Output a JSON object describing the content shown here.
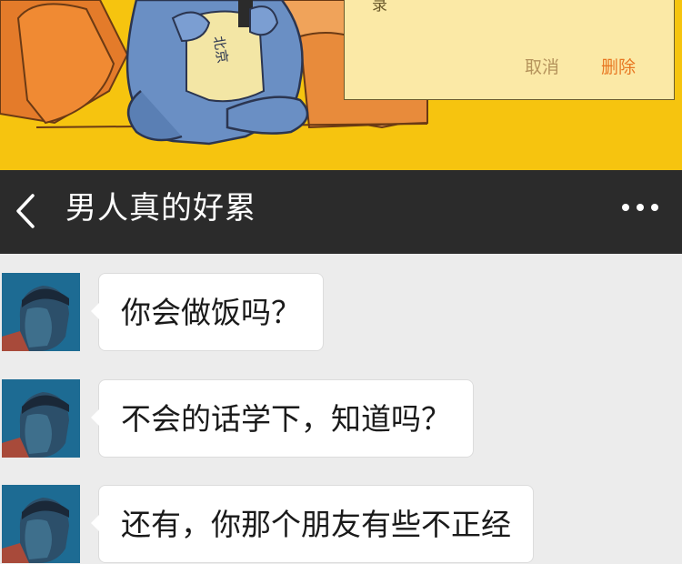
{
  "comic": {
    "dialog": {
      "partial_text": "录",
      "cancel_label": "取消",
      "delete_label": "删除"
    },
    "label_text": "北京"
  },
  "header": {
    "title": "男人真的好累",
    "back_icon": "chevron-left-icon",
    "more_icon": "more-dots-icon"
  },
  "messages": [
    {
      "sender": "avatar",
      "text": "你会做饭吗？"
    },
    {
      "sender": "avatar",
      "text": "不会的话学下，知道吗？"
    },
    {
      "sender": "avatar",
      "text": "还有，你那个朋友有些不正经"
    }
  ],
  "colors": {
    "comic_bg": "#f6c40f",
    "header_bg": "#2b2b2b",
    "chat_bg": "#ececec",
    "delete": "#e87722",
    "cancel": "#b5935c"
  }
}
